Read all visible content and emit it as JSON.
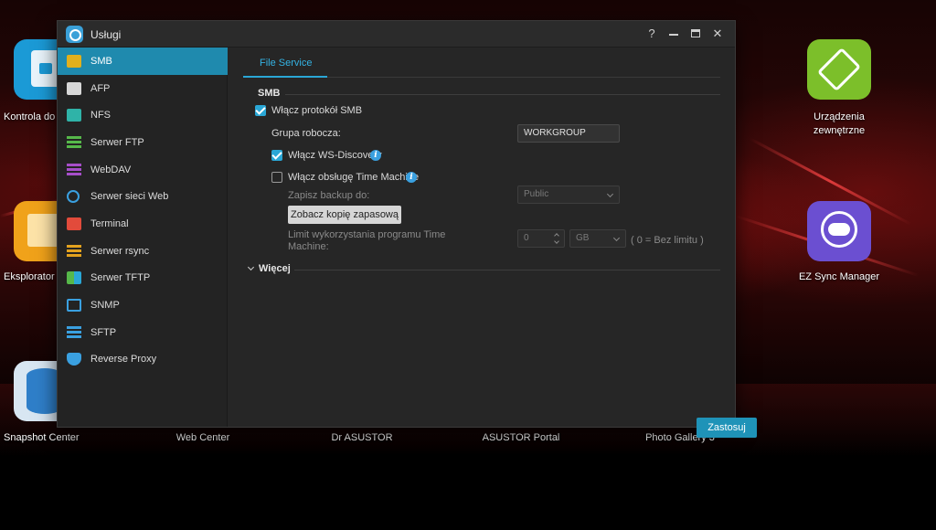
{
  "window": {
    "title": "Usługi",
    "help_icon": "help-icon",
    "minimize_icon": "minimize-icon",
    "maximize_icon": "maximize-icon",
    "close_icon": "close-icon"
  },
  "sidebar": {
    "items": [
      {
        "label": "SMB",
        "icon": "smb-icon",
        "active": true
      },
      {
        "label": "AFP",
        "icon": "afp-icon"
      },
      {
        "label": "NFS",
        "icon": "nfs-icon"
      },
      {
        "label": "Serwer FTP",
        "icon": "ftp-icon"
      },
      {
        "label": "WebDAV",
        "icon": "webdav-icon"
      },
      {
        "label": "Serwer sieci Web",
        "icon": "web-server-icon"
      },
      {
        "label": "Terminal",
        "icon": "terminal-icon"
      },
      {
        "label": "Serwer rsync",
        "icon": "rsync-icon"
      },
      {
        "label": "Serwer TFTP",
        "icon": "tftp-icon"
      },
      {
        "label": "SNMP",
        "icon": "snmp-icon"
      },
      {
        "label": "SFTP",
        "icon": "sftp-icon"
      },
      {
        "label": "Reverse Proxy",
        "icon": "reverse-proxy-icon"
      }
    ]
  },
  "tabs": [
    {
      "label": "File Service"
    }
  ],
  "smb": {
    "section_title": "SMB",
    "enable_smb": {
      "label": "Włącz protokół SMB",
      "checked": true
    },
    "workgroup": {
      "label": "Grupa robocza:",
      "value": "WORKGROUP"
    },
    "ws_discovery": {
      "label": "Włącz WS-Discovery",
      "checked": true
    },
    "time_machine": {
      "label": "Włącz obsługę Time Machine",
      "checked": false
    },
    "backup_to": {
      "label": "Zapisz backup do:",
      "value": "Public"
    },
    "view_backup_button": "Zobacz kopię zapasową",
    "tm_limit": {
      "label_line1": "Limit wykorzystania programu Time",
      "label_line2": "Machine:",
      "value": "0",
      "unit": "GB",
      "hint": "( 0 = Bez limitu )"
    },
    "more": "Więcej",
    "apply_button": "Zastosuj"
  },
  "desktop": {
    "icons": [
      {
        "label": "Kontrola do",
        "color": "#1b9ad6"
      },
      {
        "label": "Eksplorator",
        "color": "#f0a21a"
      },
      {
        "label": "Snapshot Center",
        "color": "#2f7fc9"
      },
      {
        "label": "Urządzenia",
        "label2": "zewnętrzne",
        "color": "#7cbf2a"
      },
      {
        "label": "EZ Sync Manager",
        "color": "#6b4fd1"
      }
    ],
    "bottom_labels": [
      "Web Center",
      "Dr ASUSTOR",
      "ASUSTOR Portal",
      "Photo Gallery 3"
    ]
  },
  "colors": {
    "accent": "#2aa7d6",
    "active_item": "#1f8aae",
    "apply": "#1f93b8"
  }
}
